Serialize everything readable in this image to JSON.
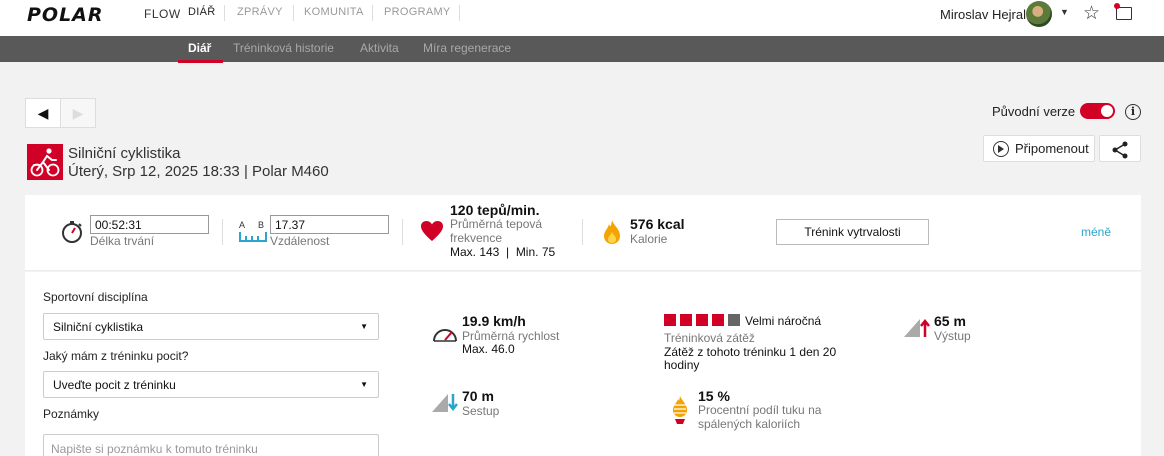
{
  "brand": {
    "logo": "POLAR",
    "product": "FLOW"
  },
  "topnav": {
    "items": [
      "DIÁŘ",
      "ZPRÁVY",
      "KOMUNITA",
      "PROGRAMY"
    ],
    "user": "Miroslav Hejral"
  },
  "subnav": {
    "items": [
      "Diář",
      "Tréninková historie",
      "Aktivita",
      "Míra regenerace"
    ]
  },
  "header": {
    "original_version_label": "Původní verze",
    "original_version_on": true,
    "remind_label": "Připomenout"
  },
  "workout": {
    "title": "Silniční cyklistika",
    "subtitle": "Úterý, Srp 12, 2025 18:33 | Polar M460"
  },
  "summary": {
    "duration_value": "00:52:31",
    "duration_label": "Délka trvání",
    "ab_a": "A",
    "ab_b": "B",
    "distance_value": "17.37",
    "distance_label": "Vzdálenost",
    "hr_value": "120 tepů/min.",
    "hr_label": "Průměrná tepová frekvence",
    "hr_minmax": "Max. 143  |  Min. 75",
    "cal_value": "576 kcal",
    "cal_label": "Kalorie",
    "training_button": "Trénink vytrvalosti",
    "less_link": "méně"
  },
  "form": {
    "sport_label": "Sportovní disciplína",
    "sport_value": "Silniční cyklistika",
    "feel_label": "Jaký mám z tréninku pocit?",
    "feel_value": "Uveďte pocit z tréninku",
    "notes_label": "Poznámky",
    "notes_placeholder": "Napište si poznámku k tomuto tréninku"
  },
  "details": {
    "speed_value": "19.9 km/h",
    "speed_label": "Průměrná rychlost",
    "speed_max": "Max. 46.0",
    "load_rating": "Velmi náročná",
    "load_level": 4,
    "load_max": 5,
    "load_label": "Tréninková zátěž",
    "load_sub": "Zátěž z tohoto tréninku 1 den 20 hodiny",
    "ascent_value": "65 m",
    "ascent_label": "Výstup",
    "descent_value": "70 m",
    "descent_label": "Sestup",
    "fat_value": "15 %",
    "fat_label": "Procentní podíl tuku na spálených kaloriích"
  },
  "colors": {
    "accent": "#d10027",
    "link": "#2aa6cc",
    "subnav_bg": "#595959"
  }
}
